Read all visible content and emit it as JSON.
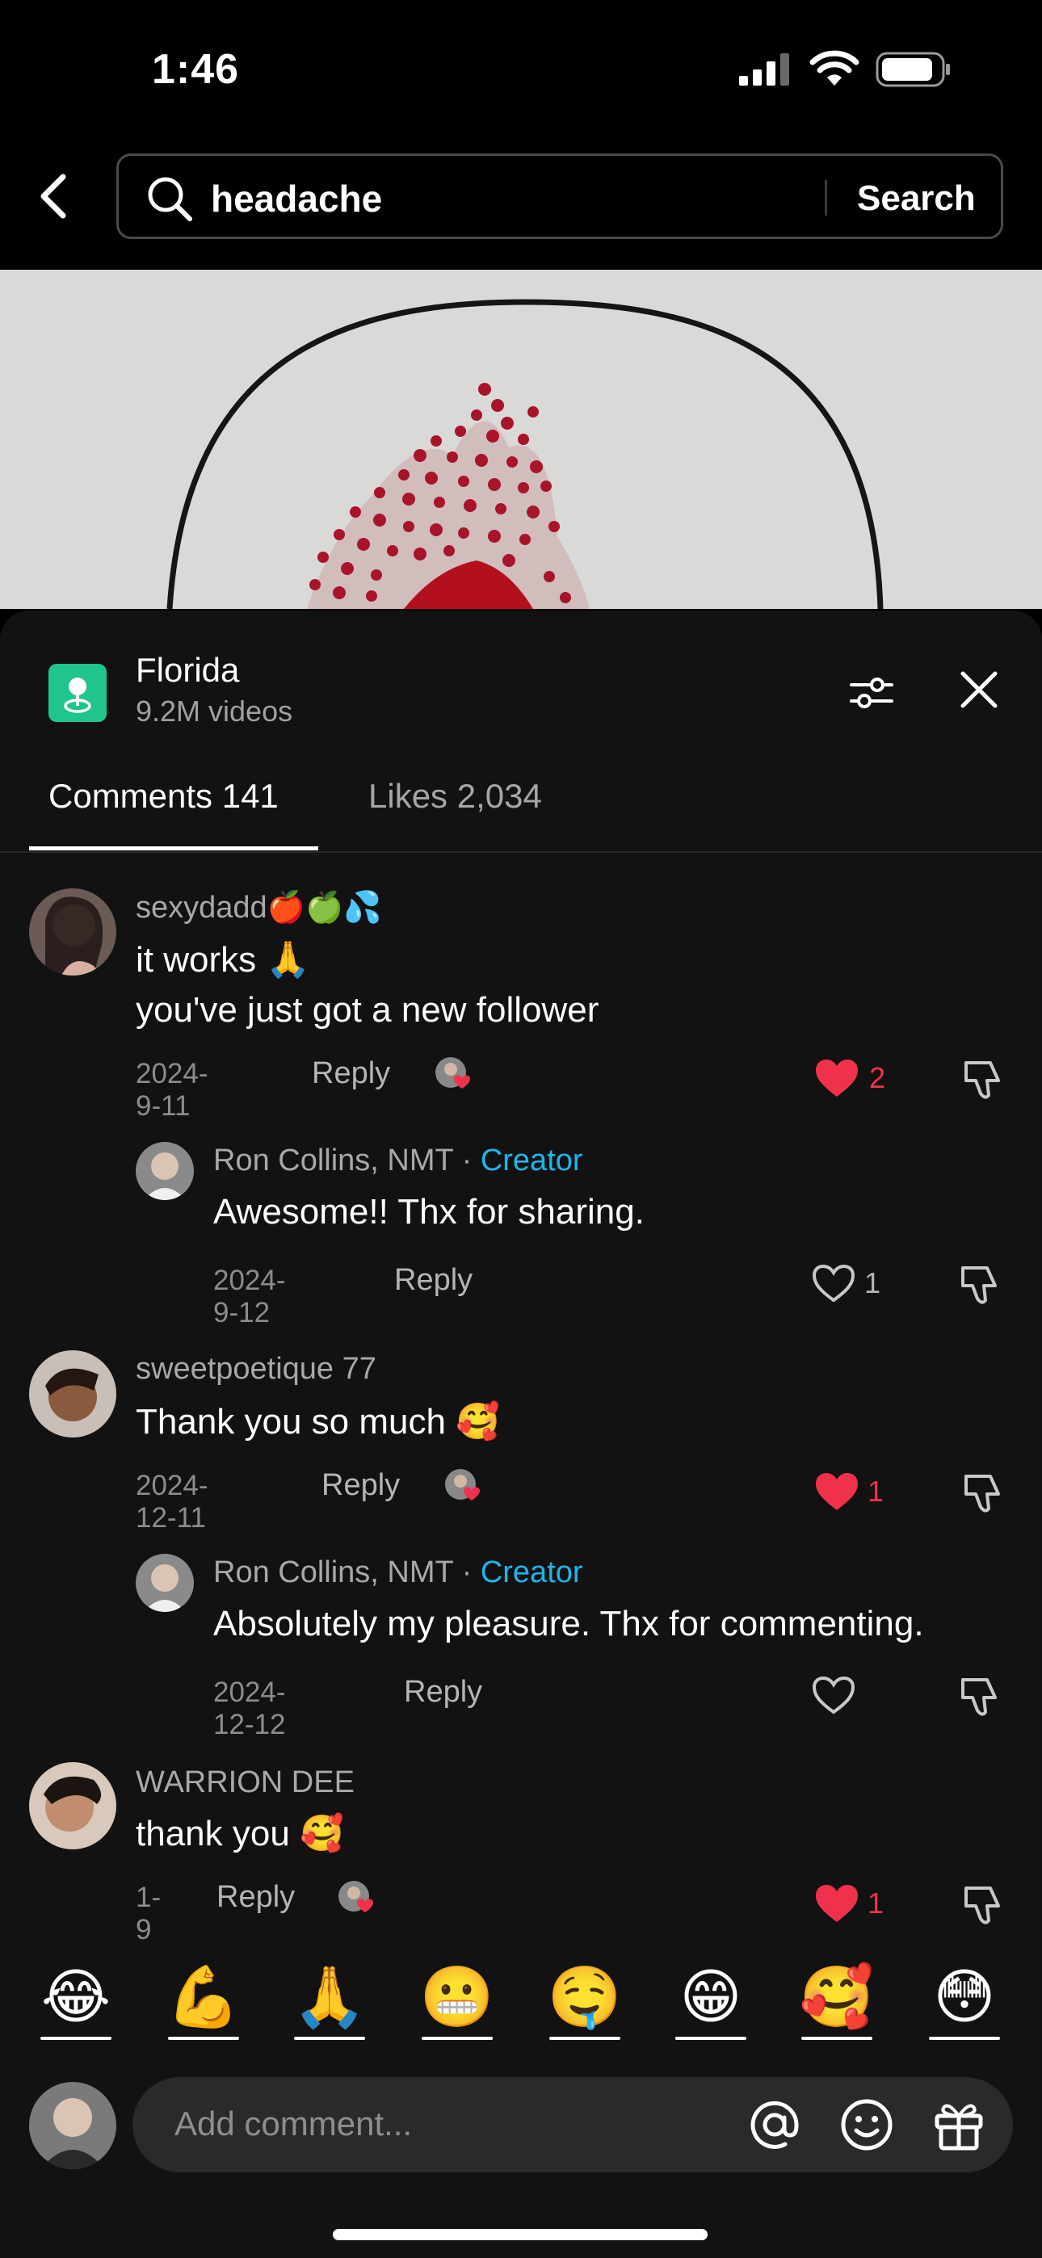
{
  "status_bar": {
    "time": "1:46"
  },
  "search": {
    "query": "headache",
    "button_label": "Search"
  },
  "sheet": {
    "location": {
      "name": "Florida",
      "count": "9.2M videos"
    },
    "tabs": [
      {
        "label": "Comments 141"
      },
      {
        "label": "Likes 2,034"
      }
    ]
  },
  "comments": [
    {
      "username": "sexydadd🍎🍏💦",
      "text_line1": "it works 🙏",
      "text_line2": "you've just got a new follower",
      "date": "2024-9-11",
      "reply_label": "Reply",
      "likes": "2",
      "liked": true
    },
    {
      "username": "Ron Collins, NMT",
      "separator": " · ",
      "creator_label": "Creator",
      "text": "Awesome!! Thx for sharing.",
      "date": "2024-9-12",
      "reply_label": "Reply",
      "likes": "1",
      "liked": false
    },
    {
      "username": "sweetpoetique 77",
      "text": "Thank you so much 🥰",
      "date": "2024-12-11",
      "reply_label": "Reply",
      "likes": "1",
      "liked": true
    },
    {
      "username": "Ron Collins, NMT",
      "separator": " · ",
      "creator_label": "Creator",
      "text": "Absolutely my pleasure. Thx for commenting.",
      "date": "2024-12-12",
      "reply_label": "Reply",
      "likes": "",
      "liked": false
    },
    {
      "username": "WARRION DEE",
      "text": "thank you 🥰",
      "date": "1-9",
      "reply_label": "Reply",
      "likes": "1",
      "liked": true
    }
  ],
  "quick_emojis": [
    "😂",
    "💪",
    "🙏",
    "😬",
    "🤤",
    "😁",
    "🥰",
    "😳"
  ],
  "input": {
    "placeholder": "Add comment..."
  },
  "colors": {
    "accent_red": "#f0314b",
    "creator_blue": "#20b4e8",
    "location_green": "#20c58e"
  }
}
